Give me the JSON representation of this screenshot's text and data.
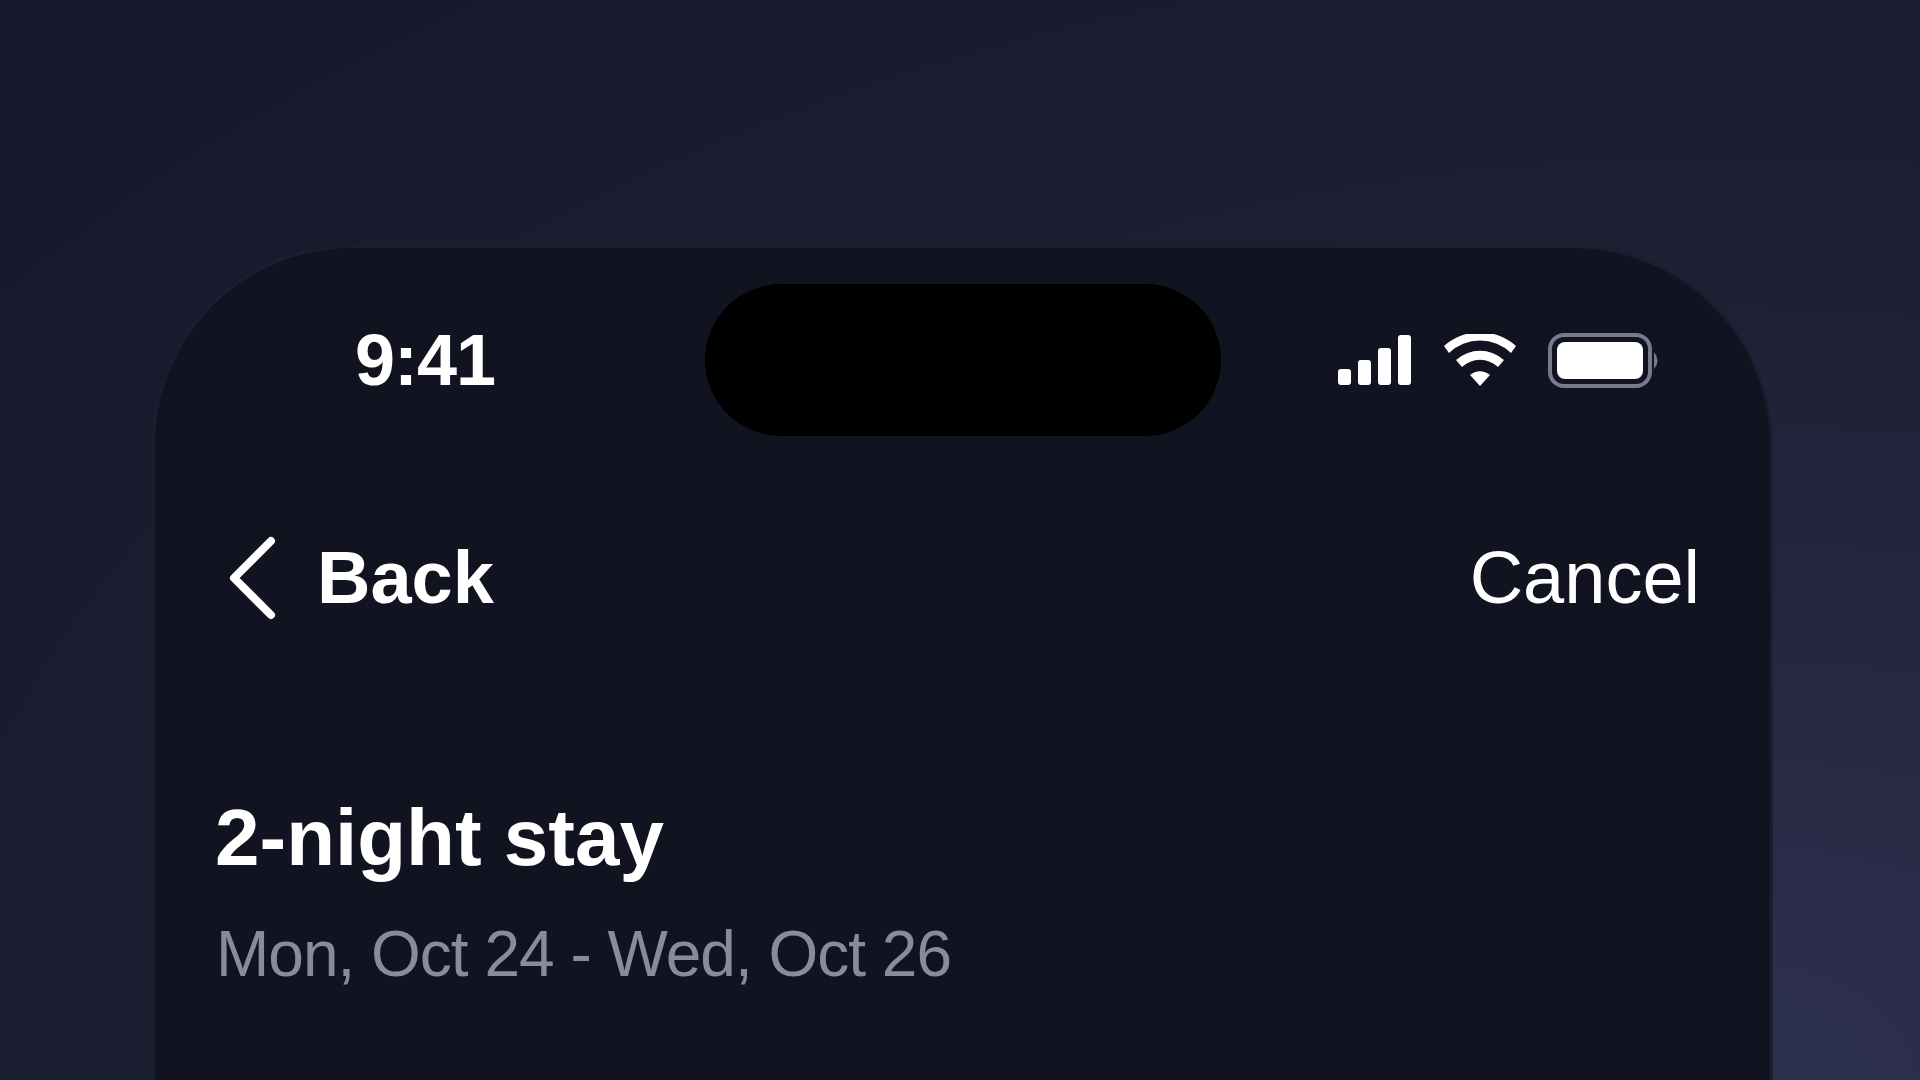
{
  "status_bar": {
    "time": "9:41"
  },
  "nav_bar": {
    "back_label": "Back",
    "cancel_label": "Cancel"
  },
  "header": {
    "title": "2-night stay",
    "dates": "Mon, Oct 24 - Wed, Oct 26"
  }
}
